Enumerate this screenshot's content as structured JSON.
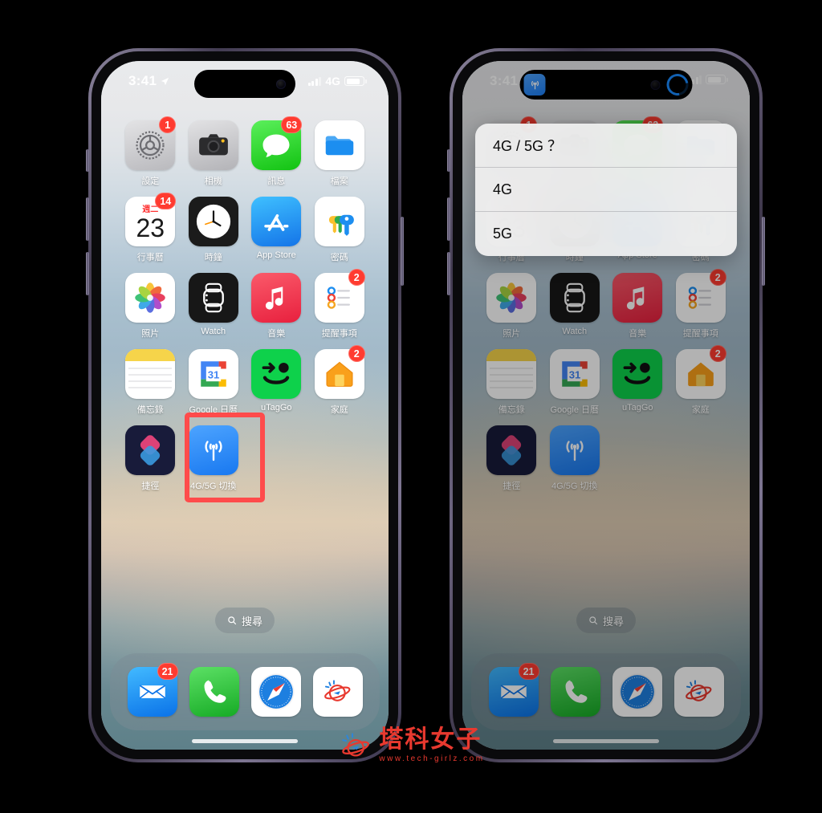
{
  "status_bar": {
    "time": "3:41",
    "network": "4G",
    "location_icon": "location-arrow-icon",
    "signal_icon": "cellular-bars-icon",
    "battery_icon": "battery-icon"
  },
  "dynamic_island": {
    "left_app_icon": "4g5g-shortcut-icon",
    "progress_icon": "loading-ring-icon",
    "camera_icon": "front-camera-icon"
  },
  "home_screen": {
    "apps": [
      {
        "name": "設定",
        "icon": "settings-icon",
        "badge": "1"
      },
      {
        "name": "相機",
        "icon": "camera-icon",
        "badge": ""
      },
      {
        "name": "訊息",
        "icon": "messages-icon",
        "badge": "63"
      },
      {
        "name": "檔案",
        "icon": "files-icon",
        "badge": ""
      },
      {
        "name": "行事曆",
        "icon": "calendar-icon",
        "badge": "14",
        "cal_weekday": "週二",
        "cal_day": "23"
      },
      {
        "name": "時鐘",
        "icon": "clock-icon",
        "badge": ""
      },
      {
        "name": "App Store",
        "icon": "appstore-icon",
        "badge": ""
      },
      {
        "name": "密碼",
        "icon": "passwords-icon",
        "badge": ""
      },
      {
        "name": "照片",
        "icon": "photos-icon",
        "badge": ""
      },
      {
        "name": "Watch",
        "icon": "watch-icon",
        "badge": ""
      },
      {
        "name": "音樂",
        "icon": "music-icon",
        "badge": ""
      },
      {
        "name": "提醒事項",
        "icon": "reminders-icon",
        "badge": "2"
      },
      {
        "name": "備忘錄",
        "icon": "notes-icon",
        "badge": ""
      },
      {
        "name": "Google 日曆",
        "icon": "google-calendar-icon",
        "badge": ""
      },
      {
        "name": "uTagGo",
        "icon": "utaggo-icon",
        "badge": ""
      },
      {
        "name": "家庭",
        "icon": "home-icon",
        "badge": "2"
      },
      {
        "name": "捷徑",
        "icon": "shortcuts-icon",
        "badge": ""
      },
      {
        "name": "4G/5G 切換",
        "icon": "4g5g-shortcut-icon",
        "badge": ""
      }
    ],
    "search": {
      "label": "搜尋",
      "icon": "search-icon"
    },
    "dock": [
      {
        "name": "Mail",
        "icon": "mail-icon",
        "badge": "21"
      },
      {
        "name": "Phone",
        "icon": "phone-icon",
        "badge": ""
      },
      {
        "name": "Safari",
        "icon": "safari-icon",
        "badge": ""
      },
      {
        "name": "Planet",
        "icon": "planet-icon",
        "badge": ""
      }
    ]
  },
  "dialog": {
    "title": "4G / 5G ？",
    "options": [
      "4G",
      "5G"
    ]
  },
  "highlight": {
    "color": "#ff4b4b",
    "target": "4G/5G 切換"
  },
  "watermark": {
    "title": "塔科女子",
    "url": "www.tech-girlz.com",
    "icon": "planet-logo-icon"
  },
  "colors": {
    "background": "#000000",
    "accent_blue": "#1878f0",
    "badge_red": "#ff3b30",
    "highlight_red": "#ff4b4b",
    "watermark_red": "#e8392f"
  }
}
